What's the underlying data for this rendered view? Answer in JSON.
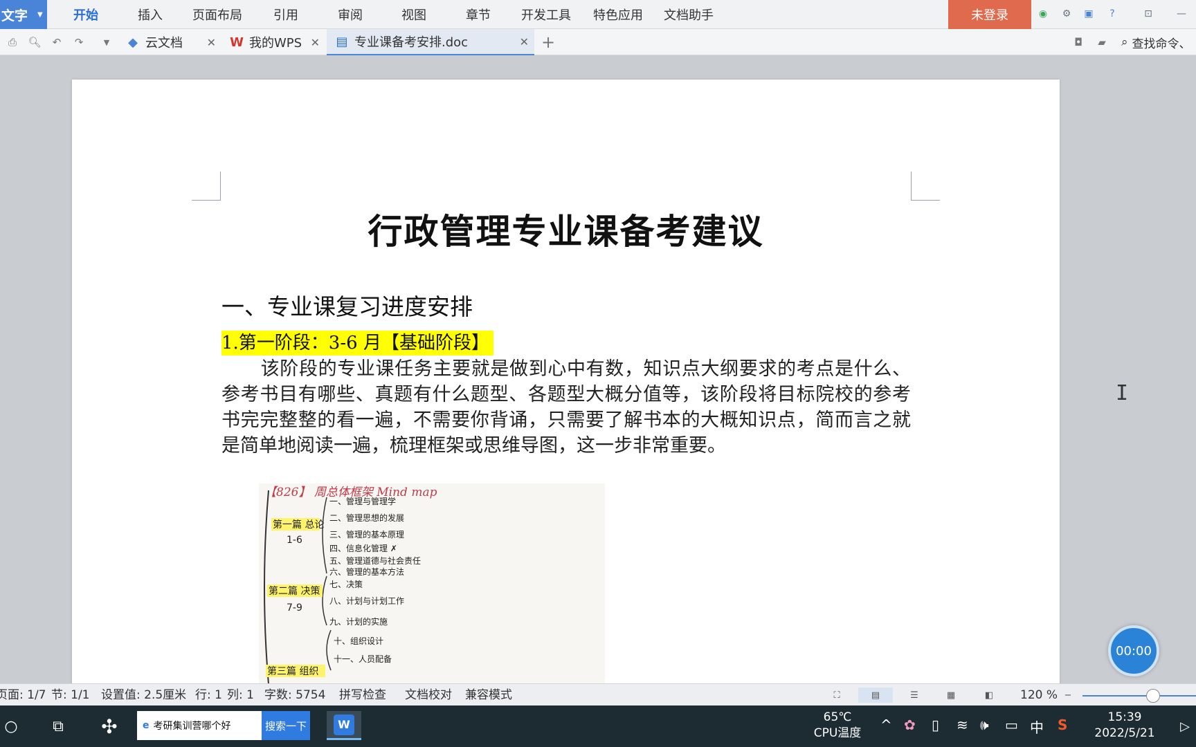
{
  "app": {
    "name": "文字",
    "menu": [
      "开始",
      "插入",
      "页面布局",
      "引用",
      "审阅",
      "视图",
      "章节",
      "开发工具",
      "特色应用",
      "文档助手"
    ],
    "active_menu": "开始",
    "login_label": "未登录"
  },
  "tabs": [
    {
      "label": "云文档",
      "icon": "cloud-icon"
    },
    {
      "label": "我的WPS",
      "icon": "wps-logo-icon"
    },
    {
      "label": "专业课备考安排.doc",
      "icon": "document-icon",
      "active": true
    }
  ],
  "search_command_label": "查找命令、",
  "document": {
    "title": "行政管理专业课备考建议",
    "section_heading": "一、专业课复习进度安排",
    "stage_heading": "1.第一阶段：3-6 月【基础阶段】",
    "paragraph": "该阶段的专业课任务主要就是做到心中有数，知识点大纲要求的考点是什么、参考书目有哪些、真题有什么题型、各题型大概分值等，该阶段将目标院校的参考书完完整整的看一遍，不需要你背诵，只需要了解书本的大概知识点，简而言之就是简单地阅读一遍，梳理框架或思维导图，这一步非常重要。",
    "mindmap": {
      "header": "【826】 周总体框架 Mind map",
      "groups": [
        {
          "label": "第一篇 总论",
          "range": "1-6"
        },
        {
          "label": "第二篇 决策",
          "range": "7-9"
        },
        {
          "label": "第三篇 组织",
          "range": ""
        }
      ],
      "items": [
        "一、管理与管理学",
        "二、管理思想的发展",
        "三、管理的基本原理",
        "四、信息化管理 ✗",
        "五、管理道德与社会责任",
        "六、管理的基本方法",
        "七、决策",
        "八、计划与计划工作",
        "九、计划的实施",
        "十、组织设计",
        "十一、人员配备"
      ]
    }
  },
  "timer_label": "00:00",
  "status": {
    "page": "页面: 1/7",
    "section": "节: 1/1",
    "setting": "设置值: 2.5厘米",
    "row": "行: 1",
    "col": "列: 1",
    "word_count": "字数: 5754",
    "spell_check": "拼写检查",
    "proofread": "文档校对",
    "compat": "兼容模式",
    "zoom": "120 %"
  },
  "taskbar": {
    "search_text": "考研集训营哪个好",
    "search_button": "搜索一下",
    "cpu_temp": "65℃",
    "cpu_label": "CPU温度",
    "ime": "中",
    "time": "15:39",
    "date": "2022/5/21"
  },
  "colors": {
    "accent": "#4a84d8",
    "login_bg": "#e06a4e",
    "highlight": "#ffff00",
    "taskbar_bg": "#1d2b33",
    "timer_bg": "#2b83d8"
  }
}
